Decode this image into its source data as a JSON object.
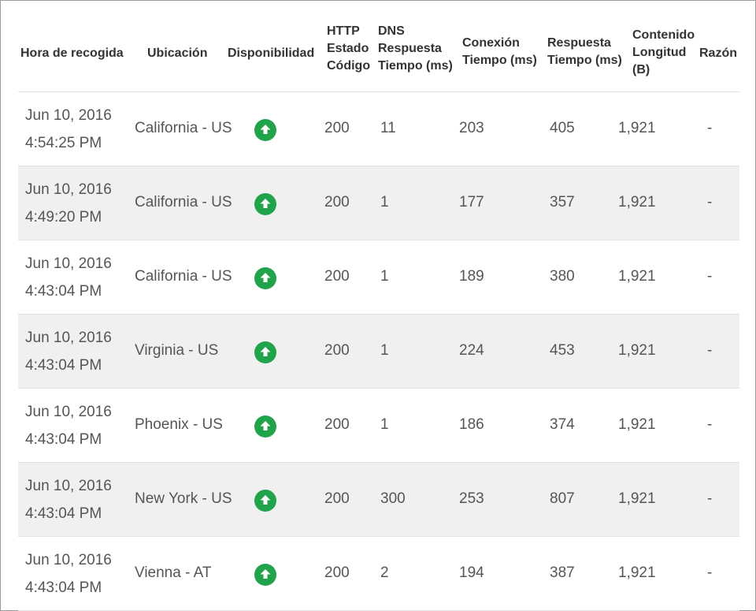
{
  "table": {
    "headers": {
      "time": [
        "Hora de recogida"
      ],
      "location": [
        "Ubicación"
      ],
      "availability": [
        "Disponibilidad"
      ],
      "http": [
        "HTTP",
        "Estado",
        "Código"
      ],
      "dns": [
        "DNS",
        "Respuesta",
        "Tiempo (ms)"
      ],
      "connection": [
        "Conexión",
        "Tiempo (ms)"
      ],
      "response": [
        "Respuesta",
        "Tiempo (ms)"
      ],
      "length": [
        "Contenido",
        "Longitud",
        "(B)"
      ],
      "reason": [
        "Razón"
      ]
    },
    "availability_icon": "arrow-up-circle-icon",
    "availability_color": "#20a34a",
    "rows": [
      {
        "date": "Jun 10, 2016",
        "time": "4:54:25 PM",
        "location": "California - US",
        "status": "up",
        "http": "200",
        "dns": "11",
        "connection": "203",
        "response": "405",
        "length": "1,921",
        "reason": "-"
      },
      {
        "date": "Jun 10, 2016",
        "time": "4:49:20 PM",
        "location": "California - US",
        "status": "up",
        "http": "200",
        "dns": "1",
        "connection": "177",
        "response": "357",
        "length": "1,921",
        "reason": "-"
      },
      {
        "date": "Jun 10, 2016",
        "time": "4:43:04 PM",
        "location": "California - US",
        "status": "up",
        "http": "200",
        "dns": "1",
        "connection": "189",
        "response": "380",
        "length": "1,921",
        "reason": "-"
      },
      {
        "date": "Jun 10, 2016",
        "time": "4:43:04 PM",
        "location": "Virginia - US",
        "status": "up",
        "http": "200",
        "dns": "1",
        "connection": "224",
        "response": "453",
        "length": "1,921",
        "reason": "-"
      },
      {
        "date": "Jun 10, 2016",
        "time": "4:43:04 PM",
        "location": "Phoenix - US",
        "status": "up",
        "http": "200",
        "dns": "1",
        "connection": "186",
        "response": "374",
        "length": "1,921",
        "reason": "-"
      },
      {
        "date": "Jun 10, 2016",
        "time": "4:43:04 PM",
        "location": "New York - US",
        "status": "up",
        "http": "200",
        "dns": "300",
        "connection": "253",
        "response": "807",
        "length": "1,921",
        "reason": "-"
      },
      {
        "date": "Jun 10, 2016",
        "time": "4:43:04 PM",
        "location": "Vienna - AT",
        "status": "up",
        "http": "200",
        "dns": "2",
        "connection": "194",
        "response": "387",
        "length": "1,921",
        "reason": "-"
      }
    ]
  }
}
